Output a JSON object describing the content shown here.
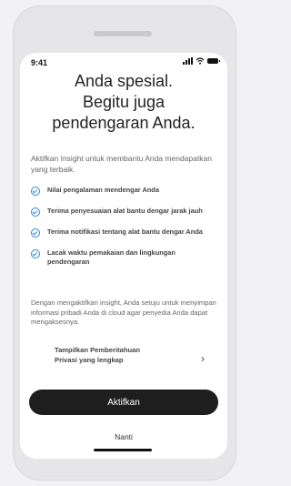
{
  "status_bar": {
    "time": "9:41",
    "signal_icon": "signal-bars-icon",
    "wifi_icon": "wifi-icon",
    "battery_icon": "battery-icon"
  },
  "header": {
    "line1": "Anda spesial.",
    "line2": "Begitu juga",
    "line3": "pendengaran Anda."
  },
  "intro": "Aktifkan Insight untuk membantu Anda mendapatkan yang terbaik.",
  "features": [
    {
      "text": "Nilai pengalaman mendengar Anda"
    },
    {
      "text": "Terima penyesuaian alat bantu dengar jarak jauh"
    },
    {
      "text": "Terima notifikasi tentang alat bantu dengar Anda"
    },
    {
      "text": "Lacak waktu pemakaian dan lingkungan pendengaran"
    }
  ],
  "consent": "Dengan mengaktifkan insight, Anda setuju untuk menyimpan informasi pribadi Anda di cloud agar penyedia Anda dapat mengaksesnya.",
  "privacy_link": {
    "line1": "Tampilkan Pemberitahuan",
    "line2": "Privasi yang lengkap",
    "chevron": "›"
  },
  "buttons": {
    "activate": "Aktifkan",
    "later": "Nanti"
  },
  "colors": {
    "accent": "#2f86e6",
    "primary_button": "#1e1e1e"
  }
}
